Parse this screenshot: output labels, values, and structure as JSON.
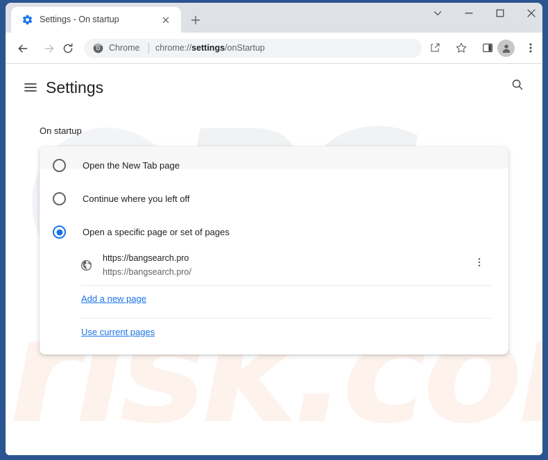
{
  "window": {
    "frame_color": "#2b5590",
    "controls": [
      {
        "name": "tab-search-chevron",
        "icon": "chevron-down-icon"
      },
      {
        "name": "minimize",
        "icon": "minimize-icon"
      },
      {
        "name": "maximize",
        "icon": "maximize-icon"
      },
      {
        "name": "close",
        "icon": "close-icon"
      }
    ]
  },
  "tabstrip": {
    "background": "#dee1e6",
    "tab": {
      "favicon": "settings-gear-icon",
      "title": "Settings - On startup",
      "close_icon": "close-icon"
    },
    "new_tab_icon": "plus-icon"
  },
  "toolbar": {
    "back_icon": "arrow-left-icon",
    "forward_icon": "arrow-right-icon",
    "reload_icon": "reload-icon",
    "omnibox": {
      "chrome_icon": "chrome-logo-icon",
      "chrome_label": "Chrome",
      "url_prefix": "chrome://",
      "url_bold": "settings",
      "url_suffix": "/onStartup",
      "background": "#f1f3f4"
    },
    "share_icon": "share-icon",
    "bookmark_icon": "star-icon",
    "side_panel_icon": "side-panel-icon",
    "profile_icon": "avatar-person-icon",
    "more_icon": "three-dots-vertical-icon"
  },
  "settings": {
    "menu_icon": "hamburger-menu-icon",
    "title": "Settings",
    "search_icon": "search-icon",
    "section_label": "On startup",
    "accent_color": "#1a73e8",
    "options": [
      {
        "label": "Open the New Tab page",
        "selected": false
      },
      {
        "label": "Continue where you left off",
        "selected": false
      },
      {
        "label": "Open a specific page or set of pages",
        "selected": true
      }
    ],
    "startup_pages": [
      {
        "icon": "globe-icon",
        "title": "https://bangsearch.pro",
        "url": "https://bangsearch.pro/",
        "menu_icon": "three-dots-vertical-icon"
      }
    ],
    "links": {
      "add_page": "Add a new page",
      "use_current": "Use current pages"
    }
  },
  "watermark": {
    "text_primary": "PC",
    "text_secondary": "risk.com",
    "color_primary": "#f1f2f3",
    "color_secondary": "#fdf2ec"
  }
}
